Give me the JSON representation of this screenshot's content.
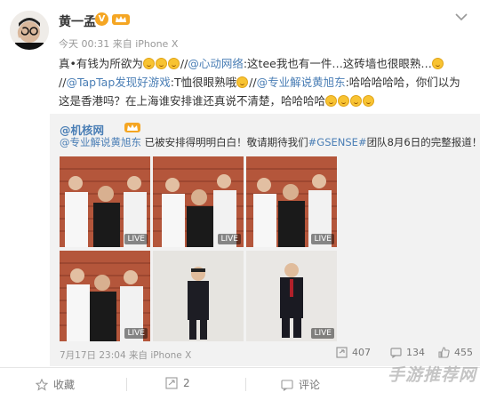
{
  "post": {
    "author": "黄一孟",
    "meta": "今天 00:31 来自 iPhone X",
    "text_parts": {
      "p1": "真•有钱为所欲为",
      "p2": "//",
      "p3": "@心动网络",
      "p4": ":这tee我也有一件…这砖墙也很眼熟…",
      "p5": "//",
      "p6": "@TapTap发现好游戏",
      "p7": ":T恤很眼熟哦",
      "p8": "//",
      "p9": "@专业解说黄旭东",
      "p10": ":哈哈哈哈哈，你们以为这是香港吗？在上海谁安排谁还真说不清楚，哈哈哈哈"
    }
  },
  "repost": {
    "author": "@机核网",
    "text_parts": {
      "mention": "@专业解说黄旭东",
      "body": " 已被安排得明明白白！敬请期待我们",
      "hashtag": "#GSENSE#",
      "tail": "团队8月6日的完整报道！"
    },
    "live_label": "LIVE",
    "time": "7月17日 23:04 来自 iPhone X",
    "reposts": "407",
    "comments": "134",
    "likes": "455"
  },
  "actions": {
    "favorite": "收藏",
    "repost_count": "2",
    "comment": "评论"
  },
  "watermark": "手游推荐网",
  "colors": {
    "link": "#4a7eb5",
    "brick": "#b4563b",
    "badge": "#f5a623",
    "repost_bg": "#f2f2f2"
  }
}
